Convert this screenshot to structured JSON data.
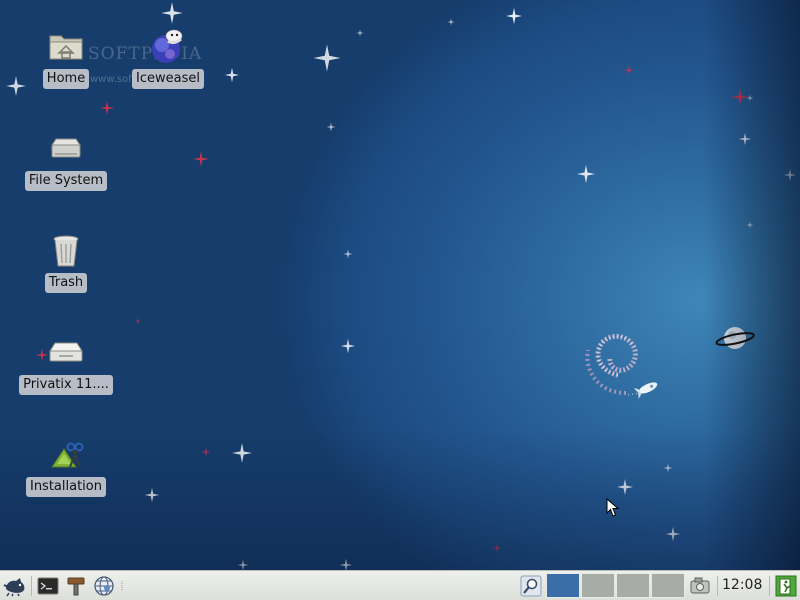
{
  "desktop": {
    "watermark": "SOFTPEDIA",
    "watermark_url": "www.softpedia.com",
    "icons": [
      {
        "label": "Home",
        "icon": "home-folder-icon"
      },
      {
        "label": "Iceweasel",
        "icon": "iceweasel-browser-icon"
      },
      {
        "label": "File System",
        "icon": "hard-drive-icon"
      },
      {
        "label": "Trash",
        "icon": "trash-icon"
      },
      {
        "label": "Privatix 11....",
        "icon": "optical-drive-icon"
      },
      {
        "label": "Installation",
        "icon": "installation-tools-icon"
      }
    ]
  },
  "taskbar": {
    "menu_icon": "xfce-mouse-icon",
    "launchers": [
      "terminal-icon",
      "settings-tools-icon",
      "web-browser-icon"
    ],
    "search_icon": "search-icon",
    "workspaces": [
      {
        "active": true
      },
      {
        "active": false
      },
      {
        "active": false
      },
      {
        "active": false
      }
    ],
    "screenshot_icon": "screenshot-icon",
    "clock": "12:08",
    "logout_icon": "logout-icon",
    "colors": {
      "panel": "#e6e8e3",
      "workspace_active": "#3a6ea8",
      "workspace_idle": "#a8aca6"
    }
  }
}
